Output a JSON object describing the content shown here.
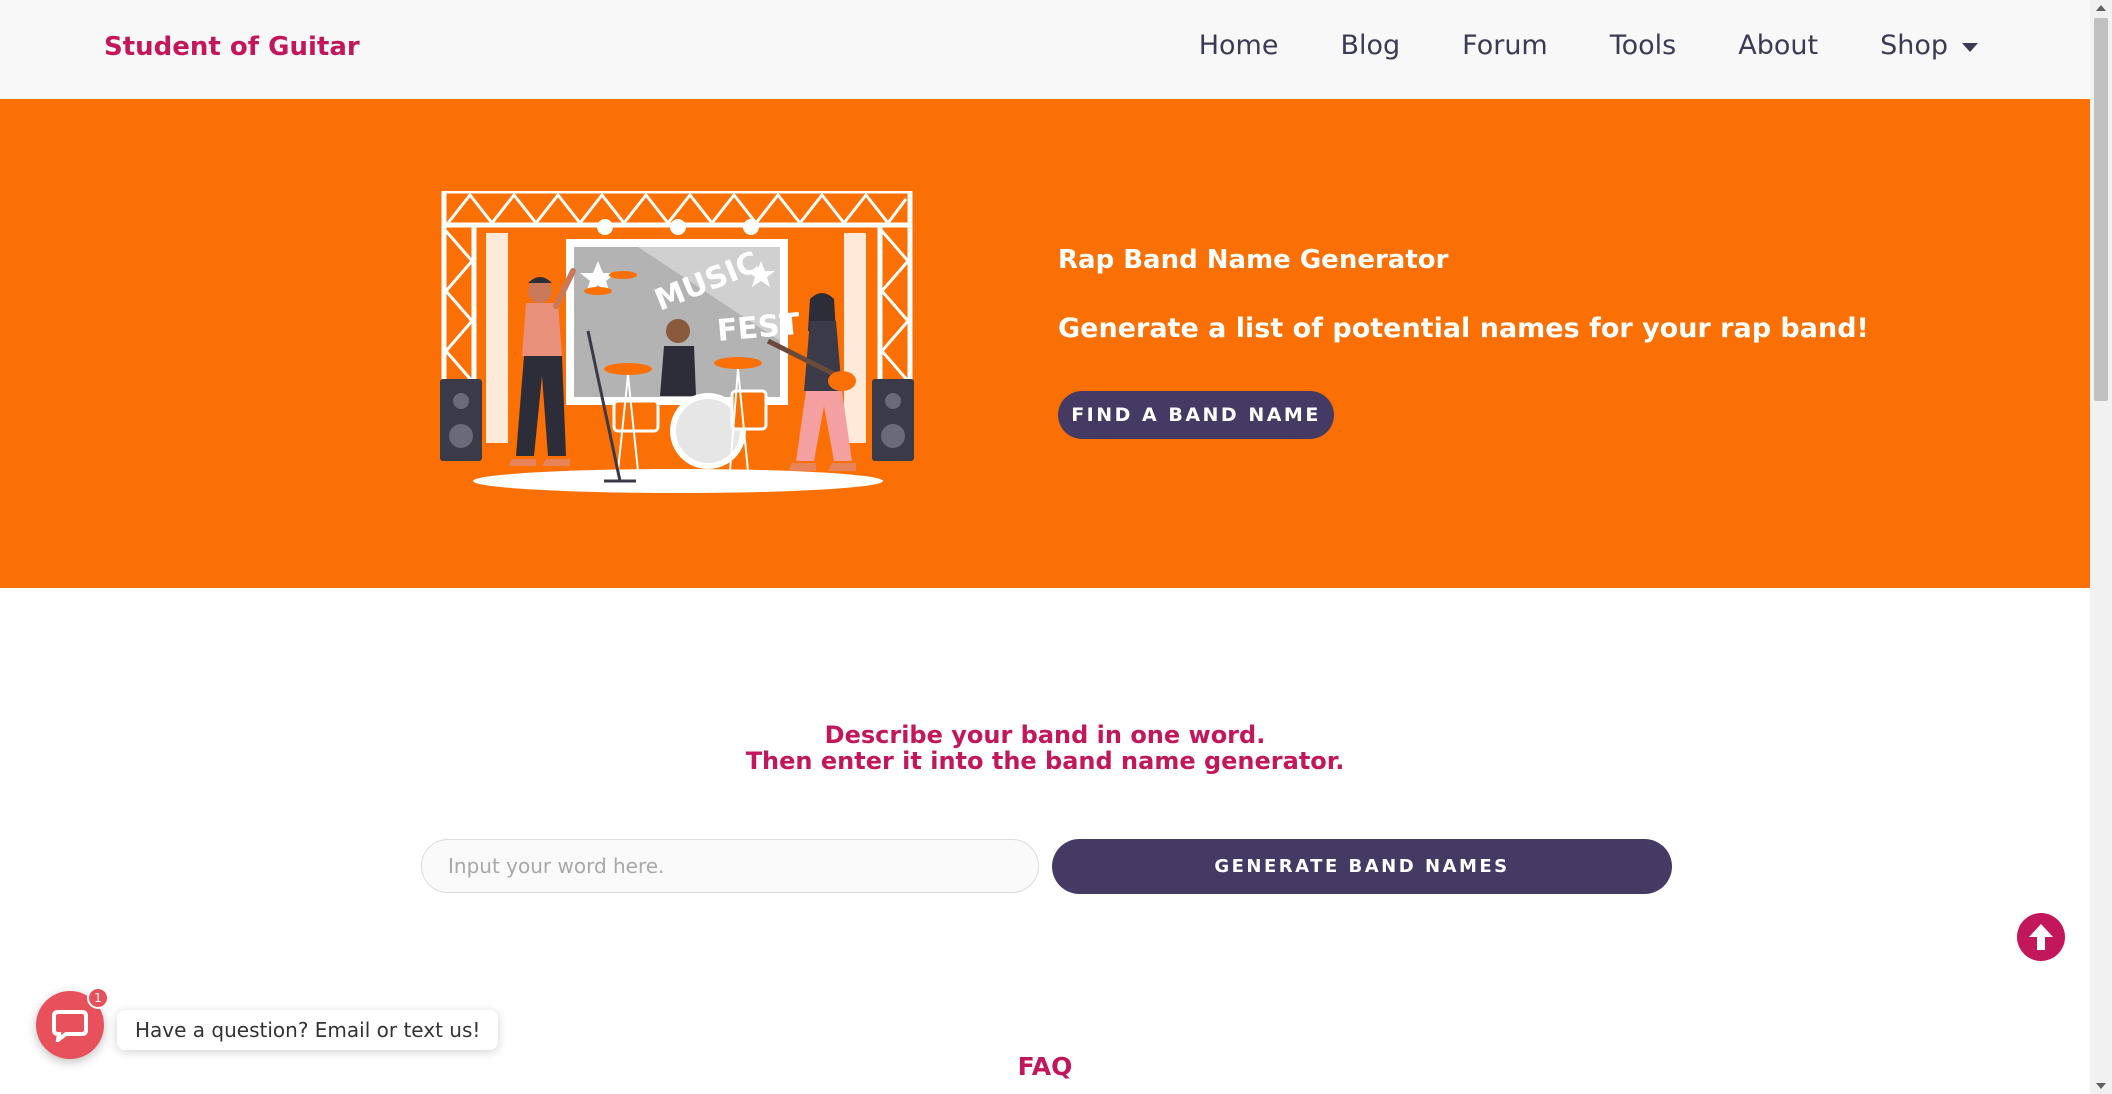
{
  "header": {
    "logo": "Student of Guitar",
    "nav": {
      "home": "Home",
      "blog": "Blog",
      "forum": "Forum",
      "tools": "Tools",
      "about": "About",
      "shop": "Shop"
    }
  },
  "hero": {
    "illustration_icon": "music-fest-stage-illustration",
    "illustration_text_1": "MUSIC",
    "illustration_text_2": "FEST",
    "title": "Rap Band Name Generator",
    "subtitle": "Generate a list of potential names for your rap band!",
    "button_label": "FIND A BAND NAME"
  },
  "generator": {
    "instruction_line1": "Describe your band in one word.",
    "instruction_line2": "Then enter it into the band name generator.",
    "input_placeholder": "Input your word here.",
    "input_value": "",
    "button_label": "GENERATE BAND NAMES"
  },
  "faq": {
    "heading": "FAQ"
  },
  "widgets": {
    "scroll_top_icon": "arrow-up-circle-icon",
    "chat_icon": "chat-icon",
    "chat_badge_count": "1",
    "chat_label": "Have a question? Email or text us!"
  },
  "colors": {
    "brand_pink": "#c2185b",
    "hero_orange": "#fa7004",
    "button_purple": "#453a63",
    "chat_red": "#e8505b"
  }
}
